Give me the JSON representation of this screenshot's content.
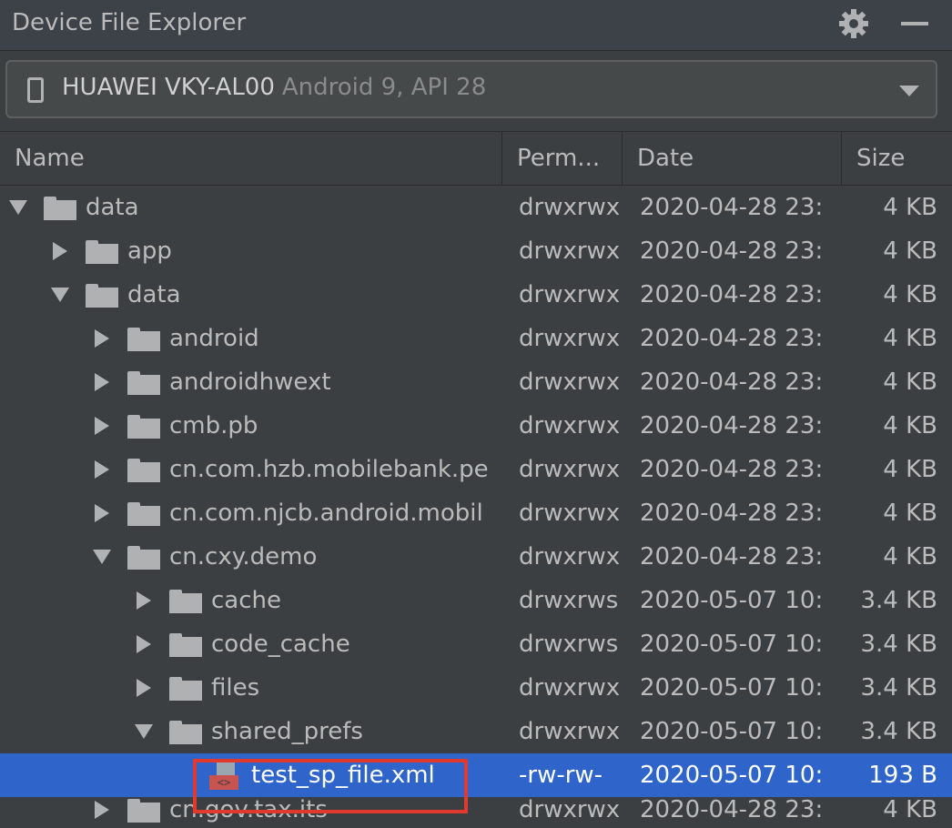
{
  "panel": {
    "title": "Device File Explorer",
    "settings_icon": "gear-icon",
    "minimize_icon": "minimize-icon"
  },
  "device": {
    "name": "HUAWEI VKY-AL00",
    "api": "Android 9, API 28"
  },
  "columns": {
    "name": "Name",
    "perm": "Perm...",
    "date": "Date",
    "size": "Size"
  },
  "rows": [
    {
      "name": "data",
      "type": "folder",
      "expanded": true,
      "depth": 0,
      "perm": "drwxrwx",
      "date": "2020-04-28 23:",
      "size": "4 KB"
    },
    {
      "name": "app",
      "type": "folder",
      "expanded": false,
      "depth": 1,
      "perm": "drwxrwx",
      "date": "2020-04-28 23:",
      "size": "4 KB"
    },
    {
      "name": "data",
      "type": "folder",
      "expanded": true,
      "depth": 1,
      "perm": "drwxrwx",
      "date": "2020-04-28 23:",
      "size": "4 KB"
    },
    {
      "name": "android",
      "type": "folder",
      "expanded": false,
      "depth": 2,
      "perm": "drwxrwx",
      "date": "2020-04-28 23:",
      "size": "4 KB"
    },
    {
      "name": "androidhwext",
      "type": "folder",
      "expanded": false,
      "depth": 2,
      "perm": "drwxrwx",
      "date": "2020-04-28 23:",
      "size": "4 KB"
    },
    {
      "name": "cmb.pb",
      "type": "folder",
      "expanded": false,
      "depth": 2,
      "perm": "drwxrwx",
      "date": "2020-04-28 23:",
      "size": "4 KB"
    },
    {
      "name": "cn.com.hzb.mobilebank.pe",
      "type": "folder",
      "expanded": false,
      "depth": 2,
      "perm": "drwxrwx",
      "date": "2020-04-28 23:",
      "size": "4 KB"
    },
    {
      "name": "cn.com.njcb.android.mobil",
      "type": "folder",
      "expanded": false,
      "depth": 2,
      "perm": "drwxrwx",
      "date": "2020-04-28 23:",
      "size": "4 KB"
    },
    {
      "name": "cn.cxy.demo",
      "type": "folder",
      "expanded": true,
      "depth": 2,
      "perm": "drwxrwx",
      "date": "2020-04-28 23:",
      "size": "4 KB"
    },
    {
      "name": "cache",
      "type": "folder",
      "expanded": false,
      "depth": 3,
      "perm": "drwxrws",
      "date": "2020-05-07 10:",
      "size": "3.4 KB"
    },
    {
      "name": "code_cache",
      "type": "folder",
      "expanded": false,
      "depth": 3,
      "perm": "drwxrws",
      "date": "2020-05-07 10:",
      "size": "3.4 KB"
    },
    {
      "name": "files",
      "type": "folder",
      "expanded": false,
      "depth": 3,
      "perm": "drwxrwx",
      "date": "2020-05-07 10:",
      "size": "3.4 KB"
    },
    {
      "name": "shared_prefs",
      "type": "folder",
      "expanded": true,
      "depth": 3,
      "perm": "drwxrwx",
      "date": "2020-05-07 10:",
      "size": "3.4 KB"
    },
    {
      "name": "test_sp_file.xml",
      "type": "xml",
      "selected": true,
      "depth": 4,
      "perm": "-rw-rw-",
      "date": "2020-05-07 10:",
      "size": "193 B"
    },
    {
      "name": "cn.gov.tax.its",
      "type": "folder",
      "expanded": false,
      "depth": 2,
      "perm": "drwxrwx",
      "date": "2020-04-28 23:",
      "size": "4 KB"
    }
  ],
  "colors": {
    "background": "#3c3f41",
    "selection": "#2f65ca",
    "highlight_outline": "#e03a2e",
    "xml_badge": "#c75450"
  }
}
